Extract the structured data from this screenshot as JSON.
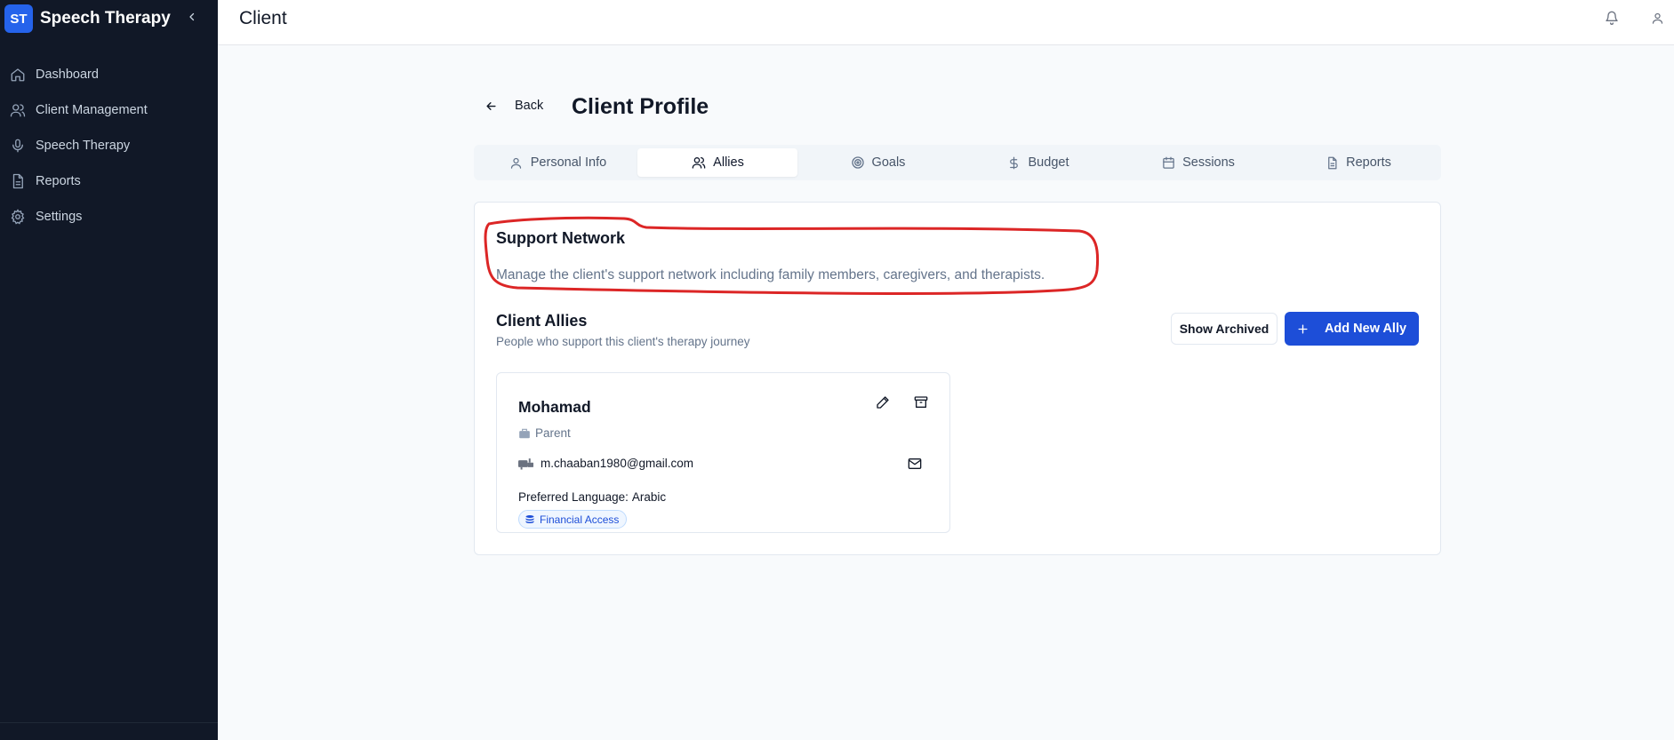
{
  "app": {
    "logo_text": "ST",
    "name": "Speech Therapy"
  },
  "sidebar": {
    "items": [
      {
        "label": "Dashboard",
        "icon": "home-icon"
      },
      {
        "label": "Client Management",
        "icon": "users-icon"
      },
      {
        "label": "Speech Therapy",
        "icon": "microphone-icon"
      },
      {
        "label": "Reports",
        "icon": "document-icon"
      },
      {
        "label": "Settings",
        "icon": "gear-icon"
      }
    ]
  },
  "header": {
    "title": "Client"
  },
  "page": {
    "back_label": "Back",
    "title": "Client Profile"
  },
  "tabs": [
    {
      "label": "Personal Info",
      "icon": "user-icon",
      "active": false
    },
    {
      "label": "Allies",
      "icon": "users-icon",
      "active": true
    },
    {
      "label": "Goals",
      "icon": "target-icon",
      "active": false
    },
    {
      "label": "Budget",
      "icon": "dollar-icon",
      "active": false
    },
    {
      "label": "Sessions",
      "icon": "calendar-icon",
      "active": false
    },
    {
      "label": "Reports",
      "icon": "document-icon",
      "active": false
    }
  ],
  "support_network": {
    "title": "Support Network",
    "description": "Manage the client's support network including family members, caregivers, and therapists."
  },
  "allies": {
    "title": "Client Allies",
    "subtitle": "People who support this client's therapy journey",
    "show_archived_label": "Show Archived",
    "add_label": "Add New Ally",
    "list": [
      {
        "name": "Mohamad",
        "role": "Parent",
        "email": "m.chaaban1980@gmail.com",
        "language_label": "Preferred Language:",
        "language": "Arabic",
        "badge": "Financial Access"
      }
    ]
  },
  "colors": {
    "sidebar_bg": "#111827",
    "accent": "#1d4ed8",
    "annotation": "#dc2626"
  }
}
